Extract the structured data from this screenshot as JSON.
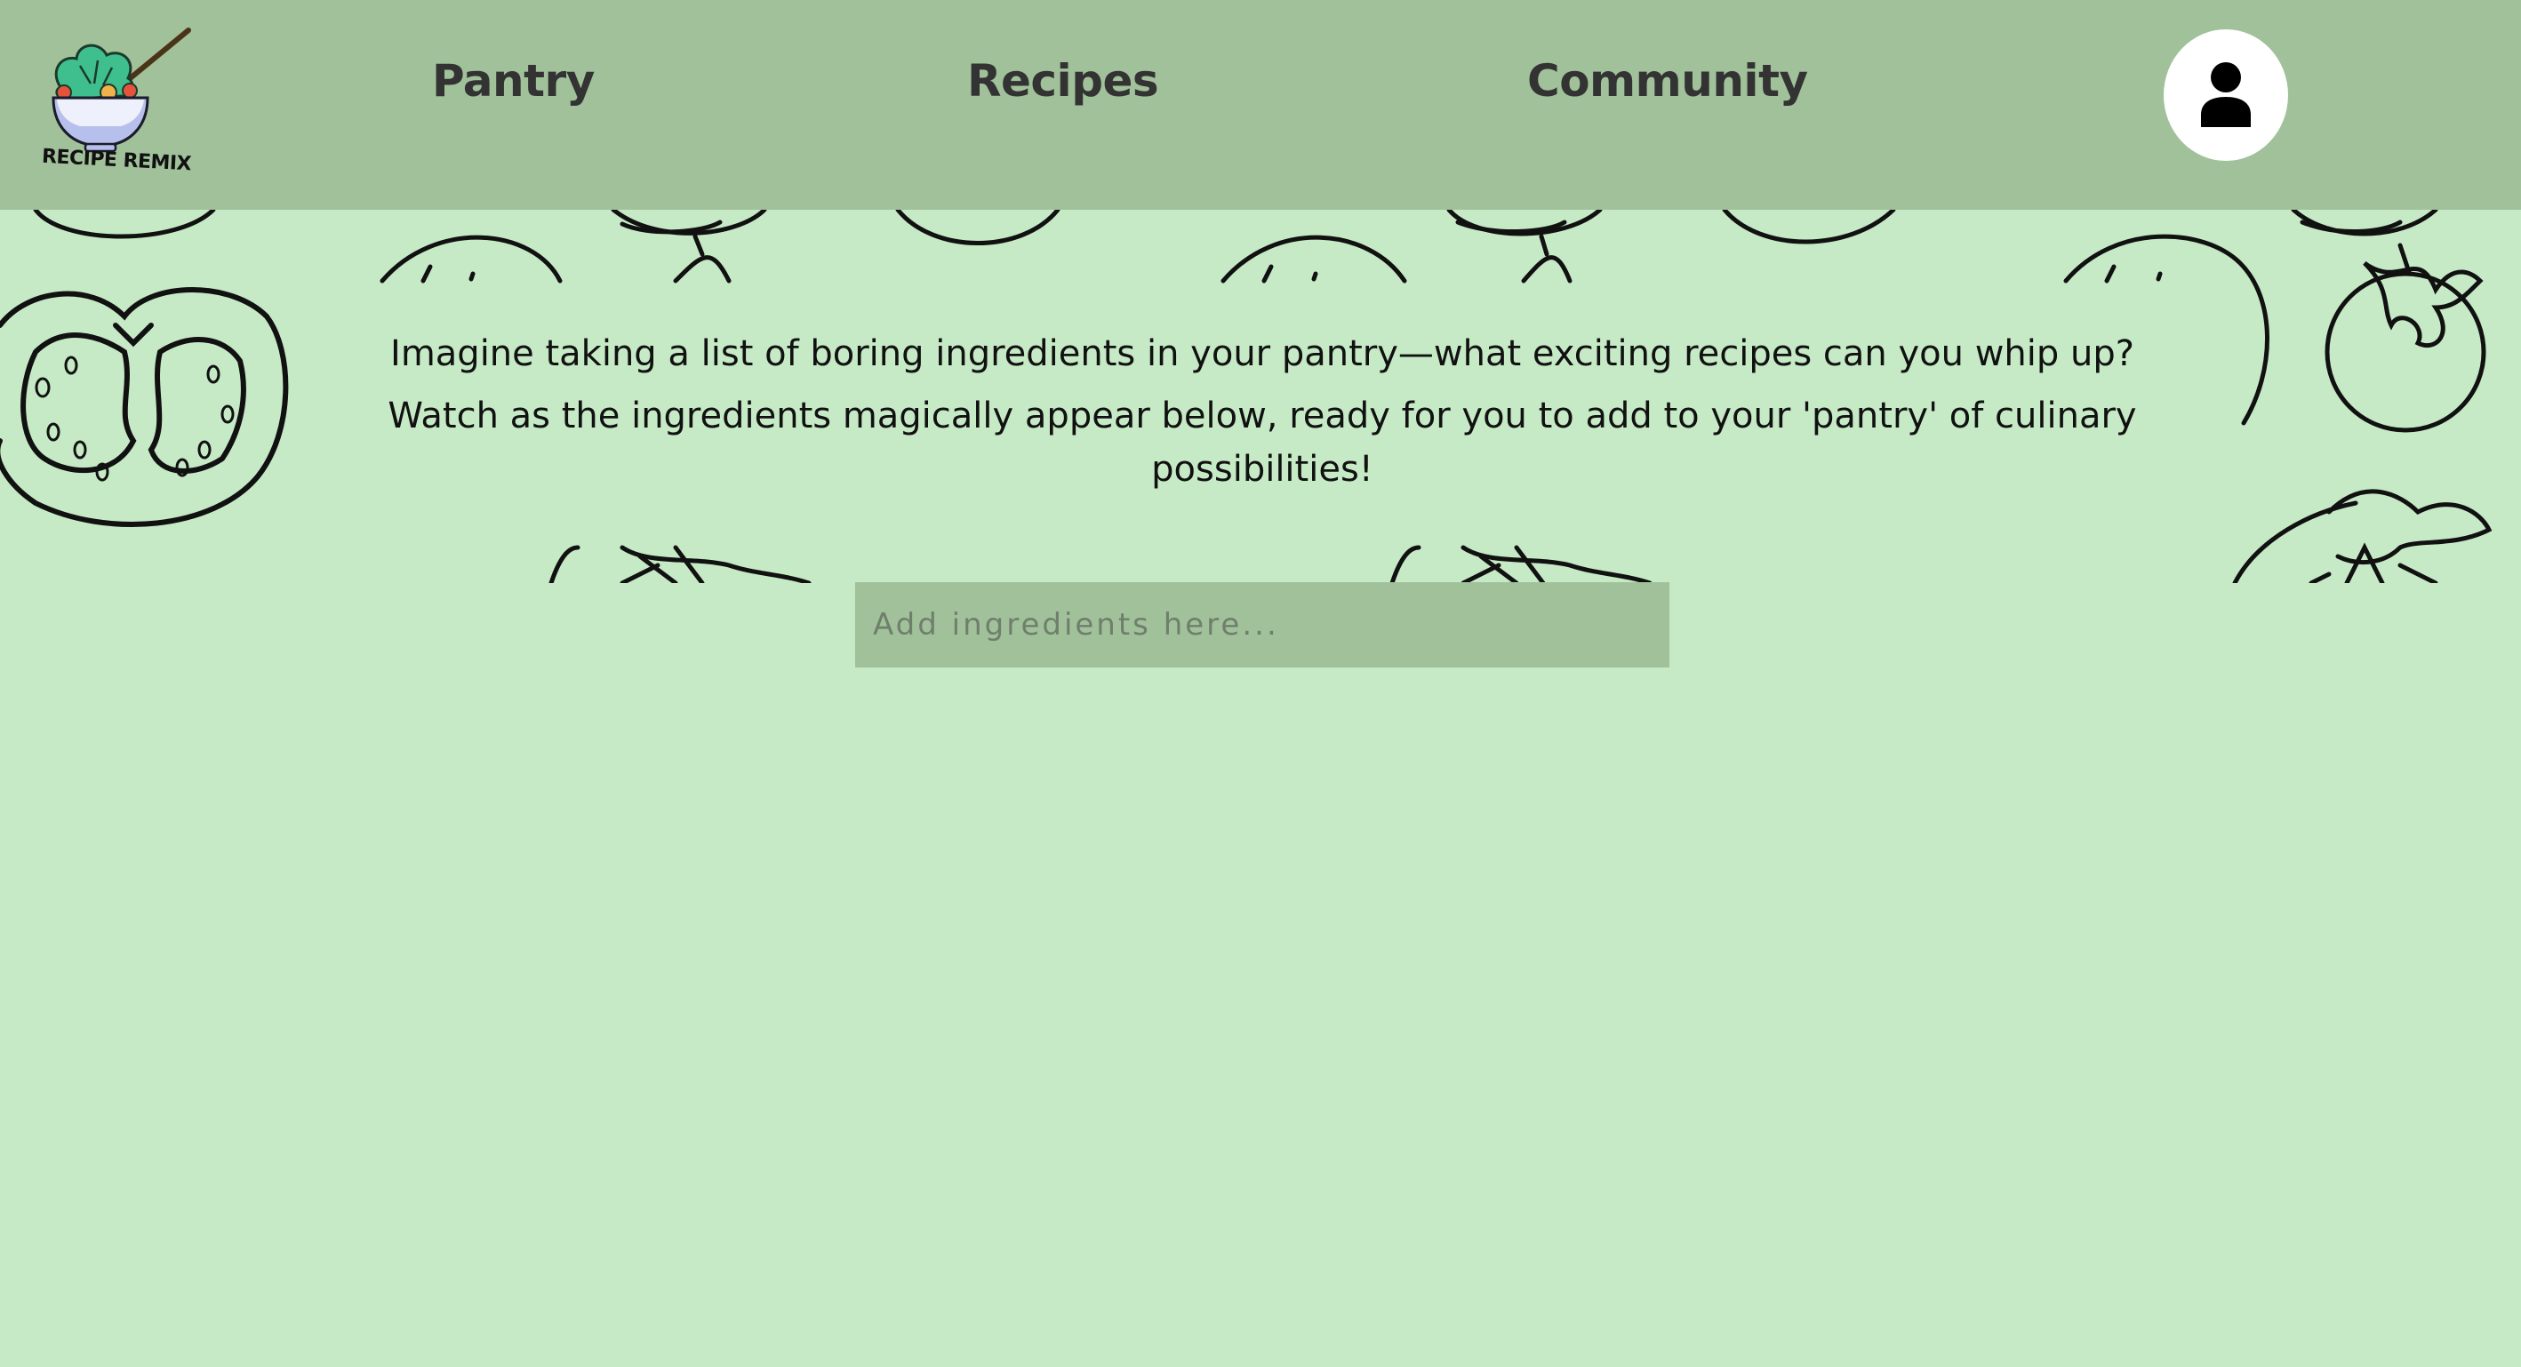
{
  "app": {
    "logo_text": "RECIPE REMIX"
  },
  "nav": {
    "items": [
      {
        "label": "Pantry"
      },
      {
        "label": "Recipes"
      },
      {
        "label": "Community"
      }
    ],
    "profile_icon": "user-icon"
  },
  "intro": {
    "line1": "Imagine taking a list of boring ingredients in your pantry—what exciting recipes can you whip up?",
    "line2": "Watch as the ingredients magically appear below, ready for you to add to your 'pantry' of culinary possibilities!"
  },
  "search": {
    "placeholder": "Add ingredients here...",
    "value": ""
  },
  "colors": {
    "background": "#c6eac6",
    "navbar": "#a1c19a",
    "input": "#a1c19a",
    "nav_text": "#333333"
  }
}
